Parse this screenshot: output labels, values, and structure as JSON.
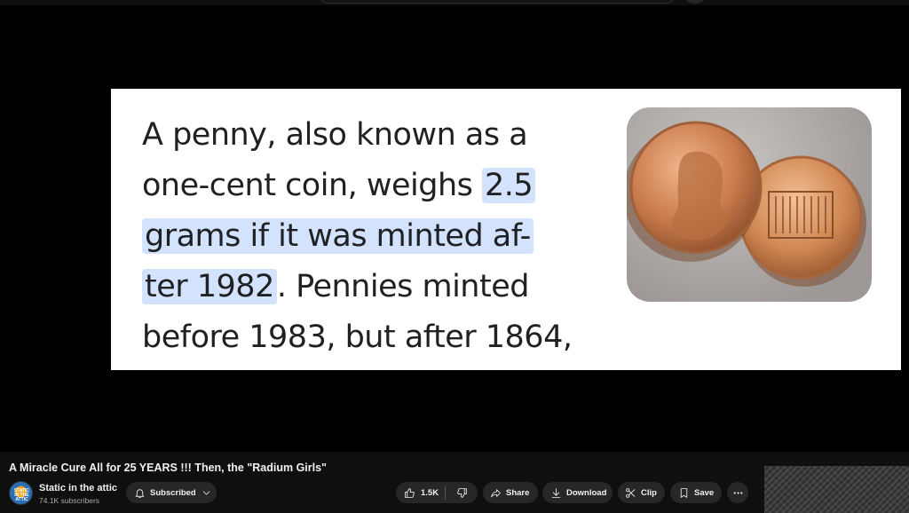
{
  "slide": {
    "line1": "A penny, also known as a",
    "line2_plain": "one-cent coin, weighs ",
    "line2_hl": "2.5",
    "line3_hl": "grams if it was minted af-",
    "line4_hl": "ter 1982",
    "line4_plain": ". Pennies minted",
    "line5": "before 1983, but after 1864,",
    "highlight_color": "#d3e3fd"
  },
  "video": {
    "title": "A Miracle Cure All for 25 YEARS !!! Then, the \"Radium Girls\""
  },
  "channel": {
    "name": "Static in the attic",
    "subscribers": "74.1K subscribers",
    "avatar_text": "STATIC IN THE ATTIC"
  },
  "actions": {
    "subscribed_label": "Subscribed",
    "like_count": "1.5K",
    "share_label": "Share",
    "download_label": "Download",
    "clip_label": "Clip",
    "save_label": "Save"
  },
  "icons": {
    "bell": "bell-icon",
    "chevron": "chevron-down-icon",
    "like": "thumbs-up-icon",
    "dislike": "thumbs-down-icon",
    "share": "share-arrow-icon",
    "download": "download-icon",
    "clip": "scissors-icon",
    "save": "bookmark-icon",
    "more": "more-horizontal-icon"
  },
  "colors": {
    "background": "#0f0f0f",
    "pill": "#272727",
    "text": "#f1f1f1",
    "secondary_text": "#aaaaaa"
  }
}
